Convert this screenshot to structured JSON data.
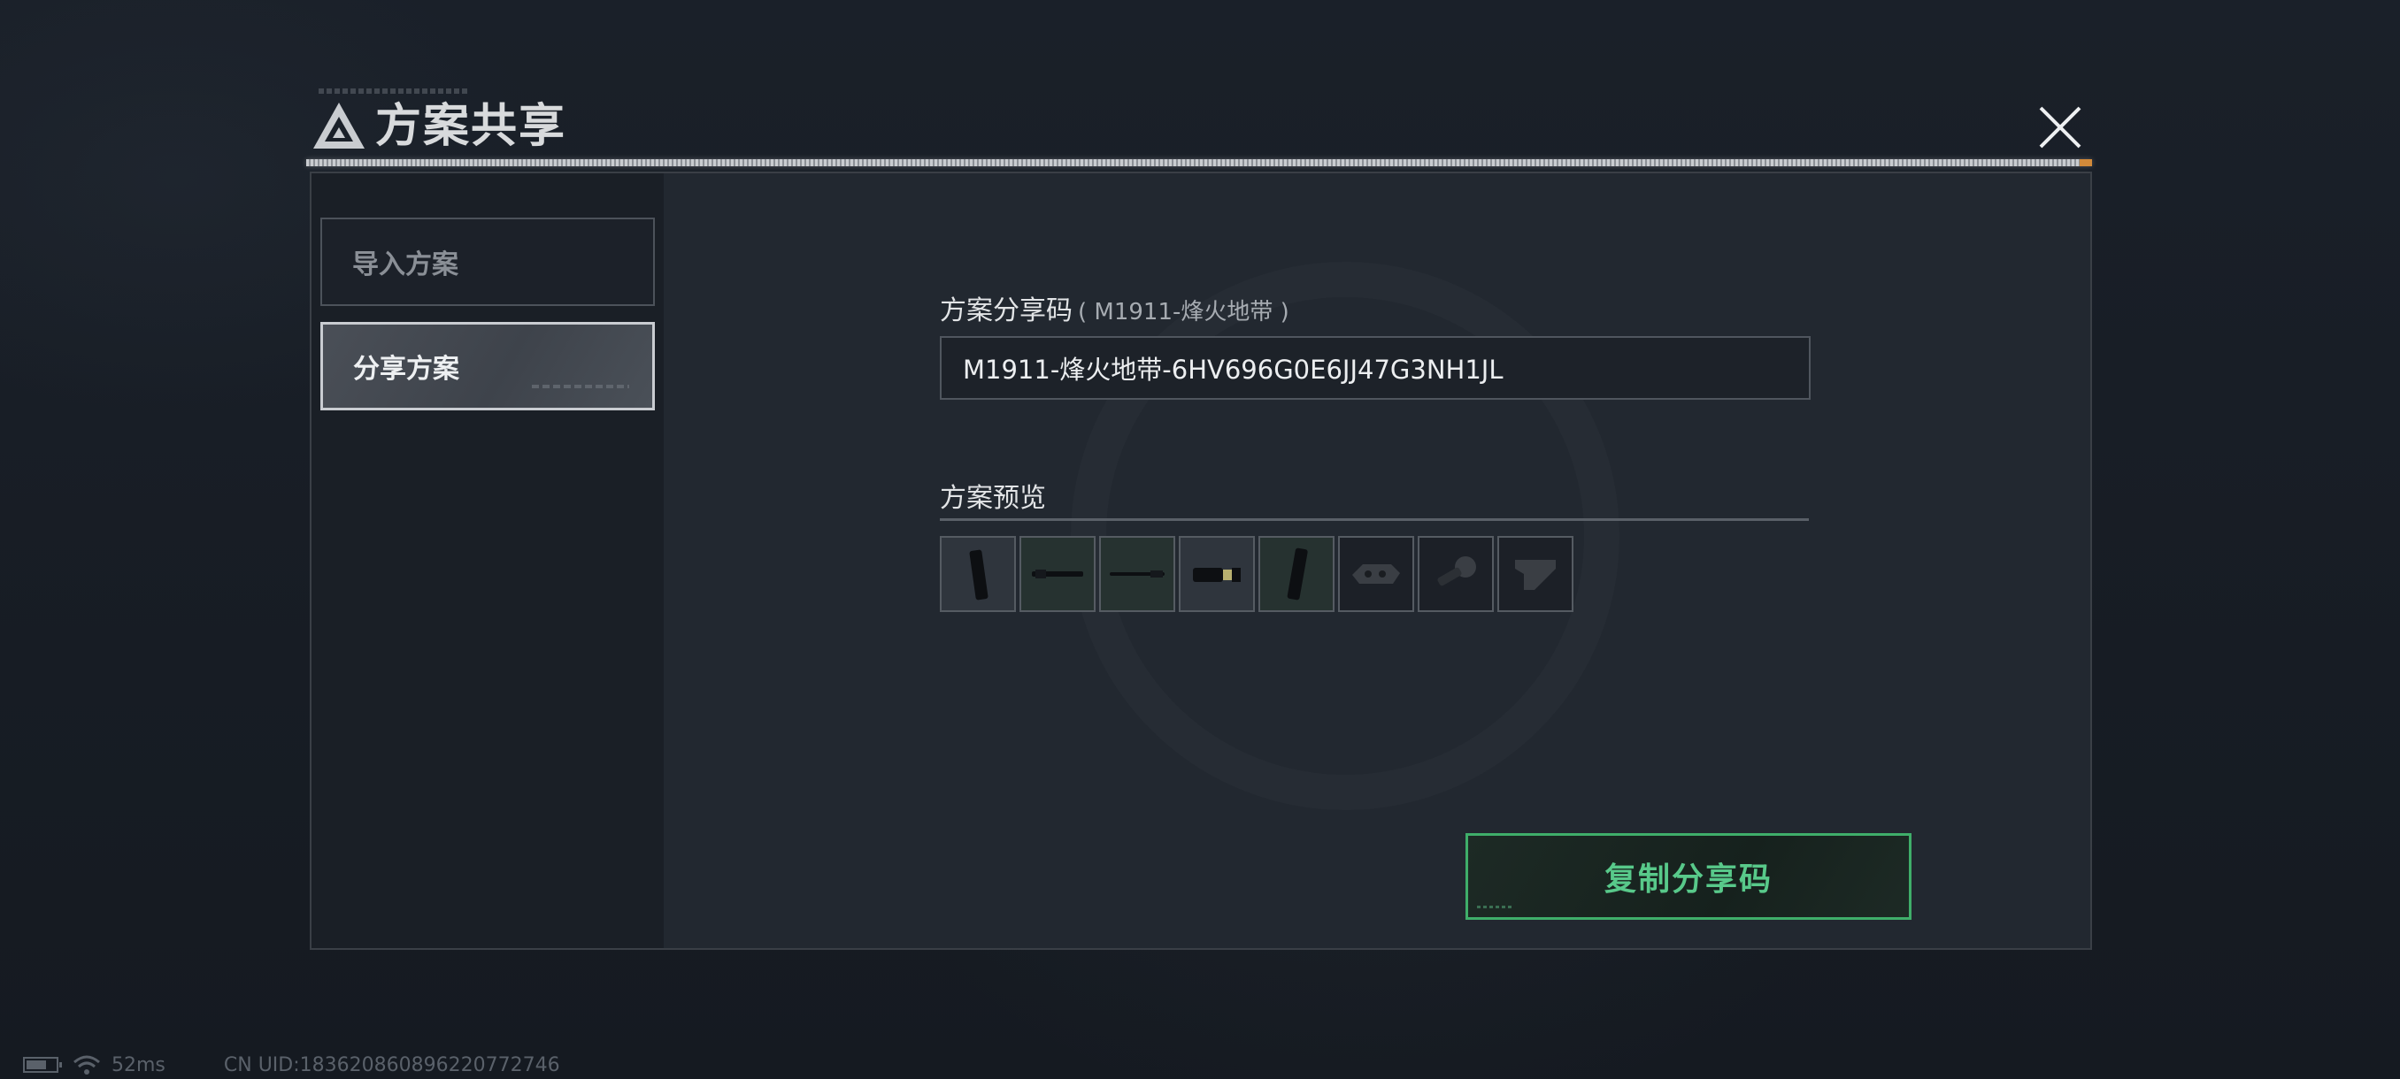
{
  "dialog": {
    "title": "方案共享",
    "close_icon": "close-icon",
    "logo_icon": "triangle-logo-icon"
  },
  "sidebar": {
    "items": [
      {
        "label": "导入方案",
        "active": false
      },
      {
        "label": "分享方案",
        "active": true
      }
    ]
  },
  "share": {
    "code_label": "方案分享码",
    "code_label_paren": "( M1911-烽火地带 )",
    "code_value": "M1911-烽火地带-6HV696G0E6JJ47G3NH1JL",
    "preview_label": "方案预览",
    "preview_items": [
      {
        "icon": "magazine-part-icon"
      },
      {
        "icon": "barrel-part-icon"
      },
      {
        "icon": "long-barrel-part-icon"
      },
      {
        "icon": "sight-part-icon"
      },
      {
        "icon": "magazine-part-icon"
      },
      {
        "icon": "grip-part-icon"
      },
      {
        "icon": "mount-part-icon"
      },
      {
        "icon": "stock-part-icon"
      }
    ],
    "copy_button_label": "复制分享码"
  },
  "status_bar": {
    "battery_icon": "battery-icon",
    "wifi_icon": "wifi-icon",
    "latency": "52ms",
    "uid": "CN UID:183620860896220772746"
  },
  "colors": {
    "accent_green": "#58c98a",
    "panel_bg": "#222830",
    "sidebar_bg": "#1a1f26",
    "header_bar_end": "#d28a3a"
  }
}
